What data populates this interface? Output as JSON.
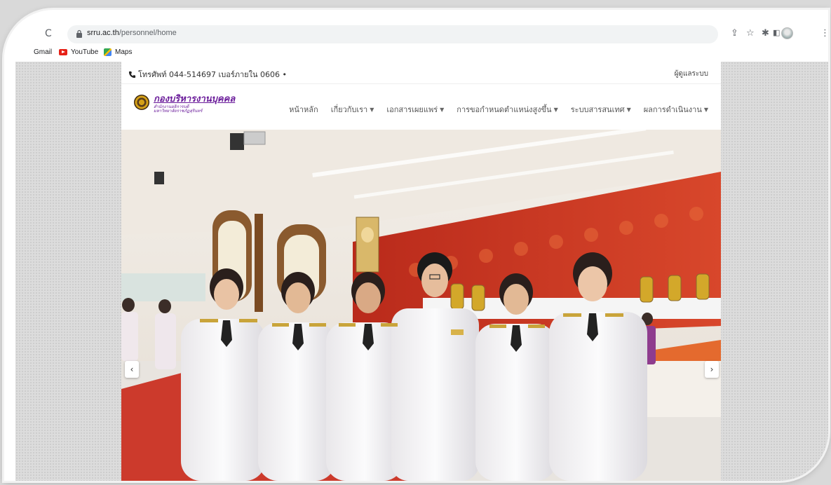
{
  "browser": {
    "url_host": "srru.ac.th",
    "url_path": "/personnel/home",
    "bookmarks": [
      {
        "label": "Gmail"
      },
      {
        "label": "YouTube"
      },
      {
        "label": "Maps"
      }
    ]
  },
  "topbar": {
    "phone": "โทรศัพท์ 044-514697 เบอร์ภายใน 0606 •",
    "admin": "ผู้ดูแลระบบ"
  },
  "logo": {
    "main": "กองบริหารงานบุคคล",
    "sub1": "สำนักงานอธิการบดี",
    "sub2": "มหาวิทยาลัยราชภัฏสุรินทร์"
  },
  "menu": [
    {
      "label": "หน้าหลัก",
      "dropdown": false
    },
    {
      "label": "เกี่ยวกับเรา",
      "dropdown": true
    },
    {
      "label": "เอกสารเผยแพร่",
      "dropdown": true
    },
    {
      "label": "การขอกำหนดตำแหน่งสูงขึ้น",
      "dropdown": true
    },
    {
      "label": "ระบบสารสนเทศ",
      "dropdown": true
    },
    {
      "label": "ผลการดำเนินงาน",
      "dropdown": true
    }
  ],
  "carousel": {
    "prev": "‹",
    "next": "›"
  },
  "colors": {
    "brand_purple": "#6a1b9a",
    "banner_red": "#c8321f",
    "carpet": "#d23a2e"
  }
}
